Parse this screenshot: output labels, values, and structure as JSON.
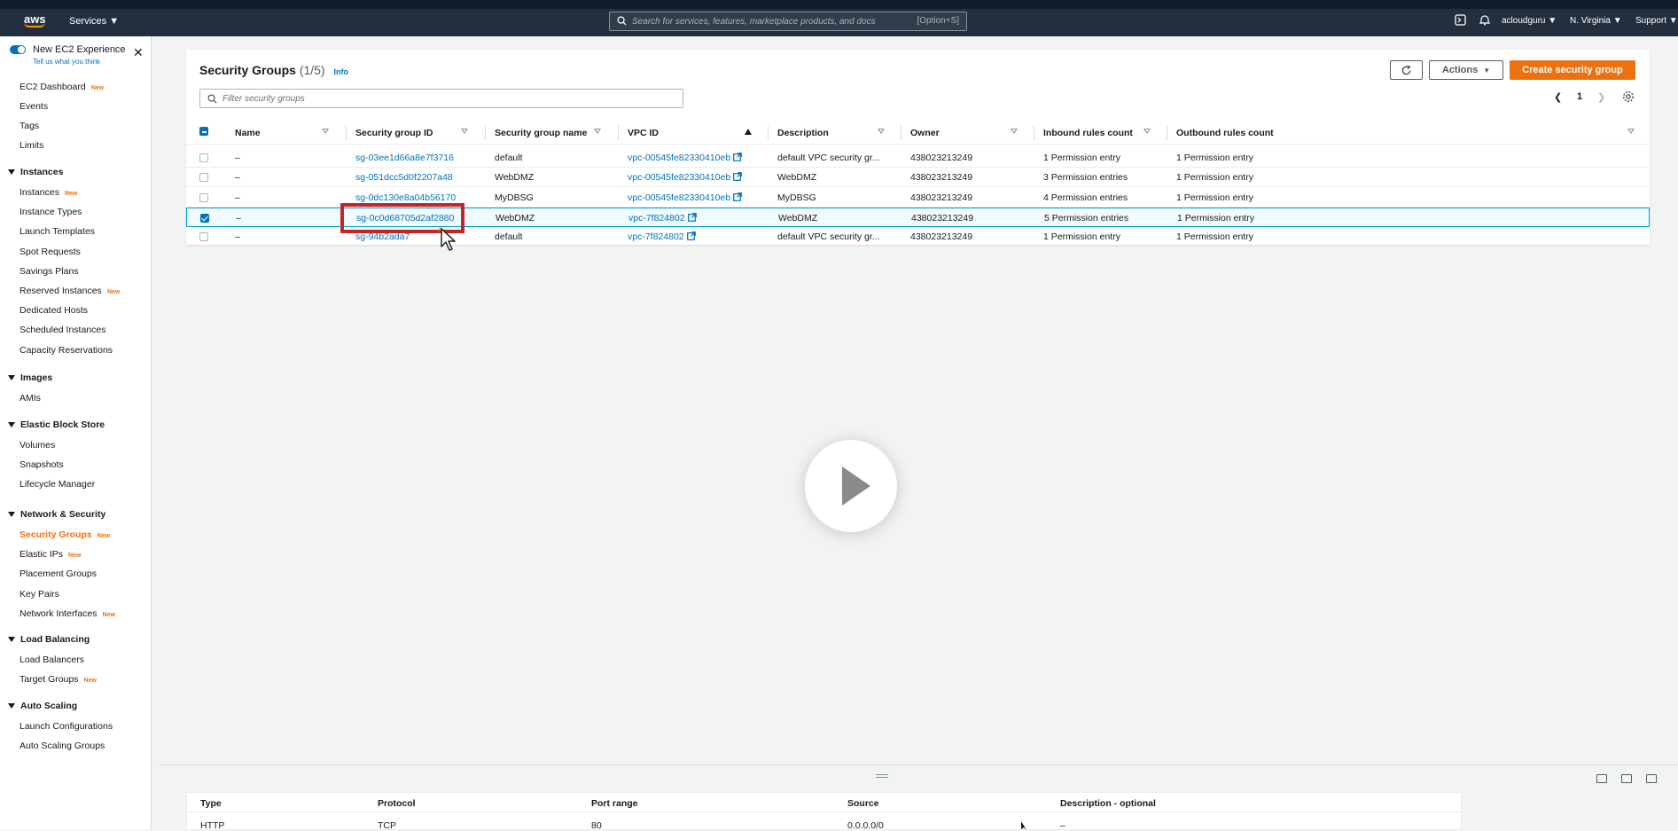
{
  "topnav": {
    "logo": "aws",
    "services": "Services",
    "search_placeholder": "Search for services, features, marketplace products, and docs",
    "search_shortcut": "[Option+S]",
    "account": "acloudguru",
    "region": "N. Virginia",
    "support": "Support"
  },
  "sidebar": {
    "new_experience": "New EC2 Experience",
    "tell_us": "Tell us what you think",
    "top_items": [
      {
        "label": "EC2 Dashboard",
        "badge": "New"
      },
      {
        "label": "Events",
        "badge": ""
      },
      {
        "label": "Tags",
        "badge": ""
      },
      {
        "label": "Limits",
        "badge": ""
      }
    ],
    "sections": [
      {
        "title": "Instances",
        "items": [
          {
            "label": "Instances",
            "badge": "New"
          },
          {
            "label": "Instance Types",
            "badge": ""
          },
          {
            "label": "Launch Templates",
            "badge": ""
          },
          {
            "label": "Spot Requests",
            "badge": ""
          },
          {
            "label": "Savings Plans",
            "badge": ""
          },
          {
            "label": "Reserved Instances",
            "badge": "New"
          },
          {
            "label": "Dedicated Hosts",
            "badge": ""
          },
          {
            "label": "Scheduled Instances",
            "badge": ""
          },
          {
            "label": "Capacity Reservations",
            "badge": ""
          }
        ]
      },
      {
        "title": "Images",
        "items": [
          {
            "label": "AMIs",
            "badge": ""
          }
        ]
      },
      {
        "title": "Elastic Block Store",
        "items": [
          {
            "label": "Volumes",
            "badge": ""
          },
          {
            "label": "Snapshots",
            "badge": ""
          },
          {
            "label": "Lifecycle Manager",
            "badge": ""
          }
        ]
      },
      {
        "title": "Network & Security",
        "items": [
          {
            "label": "Security Groups",
            "badge": "New",
            "active": true
          },
          {
            "label": "Elastic IPs",
            "badge": "New"
          },
          {
            "label": "Placement Groups",
            "badge": ""
          },
          {
            "label": "Key Pairs",
            "badge": ""
          },
          {
            "label": "Network Interfaces",
            "badge": "New"
          }
        ]
      },
      {
        "title": "Load Balancing",
        "items": [
          {
            "label": "Load Balancers",
            "badge": ""
          },
          {
            "label": "Target Groups",
            "badge": "New"
          }
        ]
      },
      {
        "title": "Auto Scaling",
        "items": [
          {
            "label": "Launch Configurations",
            "badge": ""
          },
          {
            "label": "Auto Scaling Groups",
            "badge": ""
          }
        ]
      }
    ]
  },
  "main": {
    "title": "Security Groups",
    "count": "(1/5)",
    "info": "Info",
    "actions_label": "Actions",
    "create_label": "Create security group",
    "filter_placeholder": "Filter security groups",
    "page": "1",
    "columns": [
      "Name",
      "Security group ID",
      "Security group name",
      "VPC ID",
      "Description",
      "Owner",
      "Inbound rules count",
      "Outbound rules count"
    ],
    "rows": [
      {
        "name": "–",
        "id": "sg-03ee1d66a8e7f3716",
        "group_name": "default",
        "vpc": "vpc-00545fe82330410eb",
        "description": "default VPC security gr...",
        "owner": "438023213249",
        "inbound": "1 Permission entry",
        "outbound": "1 Permission entry",
        "selected": false
      },
      {
        "name": "–",
        "id": "sg-051dcc5d0f2207a48",
        "group_name": "WebDMZ",
        "vpc": "vpc-00545fe82330410eb",
        "description": "WebDMZ",
        "owner": "438023213249",
        "inbound": "3 Permission entries",
        "outbound": "1 Permission entry",
        "selected": false
      },
      {
        "name": "–",
        "id": "sg-0dc130e8a04b56170",
        "group_name": "MyDBSG",
        "vpc": "vpc-00545fe82330410eb",
        "description": "MyDBSG",
        "owner": "438023213249",
        "inbound": "4 Permission entries",
        "outbound": "1 Permission entry",
        "selected": false
      },
      {
        "name": "–",
        "id": "sg-0c0d68705d2af2880",
        "group_name": "WebDMZ",
        "vpc": "vpc-7f824802",
        "description": "WebDMZ",
        "owner": "438023213249",
        "inbound": "5 Permission entries",
        "outbound": "1 Permission entry",
        "selected": true
      },
      {
        "name": "–",
        "id": "sg-94b2ada7",
        "group_name": "default",
        "vpc": "vpc-7f824802",
        "description": "default VPC security gr...",
        "owner": "438023213249",
        "inbound": "1 Permission entry",
        "outbound": "1 Permission entry",
        "selected": false
      }
    ]
  },
  "details": {
    "columns": [
      "Type",
      "Protocol",
      "Port range",
      "Source",
      "Description - optional"
    ],
    "first_row": [
      "HTTP",
      "TCP",
      "80",
      "0.0.0.0/0",
      "–"
    ]
  },
  "colors": {
    "nav_bg": "#232f3e",
    "accent": "#ec7211",
    "link": "#0073bb",
    "highlight": "#c1252a"
  }
}
